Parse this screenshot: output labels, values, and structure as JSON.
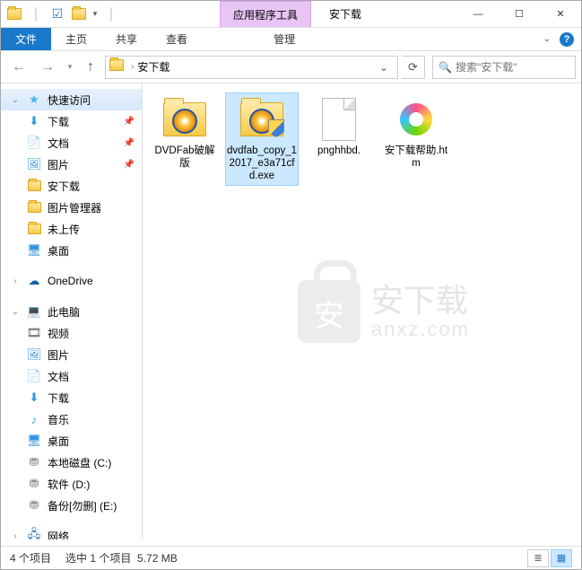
{
  "titlebar": {
    "tool_tab": "应用程序工具",
    "title": "安下载"
  },
  "ribbon": {
    "file": "文件",
    "home": "主页",
    "share": "共享",
    "view": "查看",
    "manage": "管理"
  },
  "nav": {
    "path": "安下载",
    "search_placeholder": "搜索\"安下载\""
  },
  "sidebar": {
    "quick_access": "快速访问",
    "downloads": "下载",
    "documents": "文档",
    "pictures": "图片",
    "anxz": "安下载",
    "pic_manager": "图片管理器",
    "not_uploaded": "未上传",
    "desktop": "桌面",
    "onedrive": "OneDrive",
    "this_pc": "此电脑",
    "videos": "视频",
    "pictures2": "图片",
    "documents2": "文档",
    "downloads2": "下载",
    "music": "音乐",
    "desktop2": "桌面",
    "drive_c": "本地磁盘 (C:)",
    "drive_d": "软件 (D:)",
    "drive_e": "备份[勿删] (E:)",
    "network": "网络"
  },
  "files": [
    {
      "name": "DVDFab破解版",
      "type": "folder-fox"
    },
    {
      "name": "dvdfab_copy_12017_e3a71cfd.exe",
      "type": "exe-shield",
      "selected": true
    },
    {
      "name": "pnghhbd.",
      "type": "blank"
    },
    {
      "name": "安下载帮助.htm",
      "type": "htm"
    }
  ],
  "watermark": {
    "line1": "安下载",
    "line2": "anxz.com"
  },
  "status": {
    "count": "4 个项目",
    "selection": "选中 1 个项目",
    "size": "5.72 MB"
  }
}
